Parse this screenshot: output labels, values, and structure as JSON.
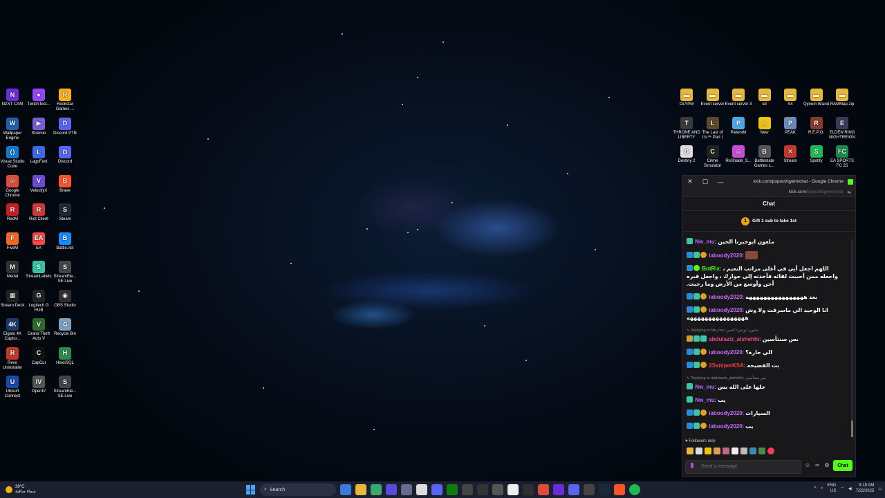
{
  "desktop_left": [
    {
      "label": "NZXT CAM",
      "color": "#6a2bd8",
      "glyph": "N"
    },
    {
      "label": "TwitchTest...",
      "color": "#9146ff",
      "glyph": "●"
    },
    {
      "label": "Rockstar Games ...",
      "color": "#fcaf17",
      "glyph": "R"
    },
    {
      "label": "Wallpaper Engine",
      "color": "#1e5fae",
      "glyph": "W"
    },
    {
      "label": "Stremio",
      "color": "#7b5bd6",
      "glyph": "▶"
    },
    {
      "label": "Discord PTB",
      "color": "#5865f2",
      "glyph": "D"
    },
    {
      "label": "Visual Studio Code",
      "color": "#0e7ad1",
      "glyph": "⟨⟩"
    },
    {
      "label": "LagoFast",
      "color": "#3a6ae8",
      "glyph": "L"
    },
    {
      "label": "Discord",
      "color": "#5865f2",
      "glyph": "D"
    },
    {
      "label": "Google Chrome",
      "color": "#dd4b39",
      "glyph": "◎"
    },
    {
      "label": "VelocityX",
      "color": "#6a4ad8",
      "glyph": "V"
    },
    {
      "label": "Brave",
      "color": "#fb542b",
      "glyph": "B"
    },
    {
      "label": "RedM",
      "color": "#c81d25",
      "glyph": "R"
    },
    {
      "label": "Riot Client",
      "color": "#d13639",
      "glyph": "R"
    },
    {
      "label": "Steam",
      "color": "#1b2838",
      "glyph": "S"
    },
    {
      "label": "FiveM",
      "color": "#f26722",
      "glyph": "F"
    },
    {
      "label": "EA",
      "color": "#ff4747",
      "glyph": "EA"
    },
    {
      "label": "Battle.net",
      "color": "#148eff",
      "glyph": "B"
    },
    {
      "label": "Medal",
      "color": "#333",
      "glyph": "M"
    },
    {
      "label": "StreamLabels",
      "color": "#31c3a2",
      "glyph": "S"
    },
    {
      "label": "StreamEle... SE.Live",
      "color": "#444",
      "glyph": "S"
    },
    {
      "label": "Stream Deck",
      "color": "#222",
      "glyph": "▦"
    },
    {
      "label": "Logitech G HUB",
      "color": "#222",
      "glyph": "G"
    },
    {
      "label": "OBS Studio",
      "color": "#302e31",
      "glyph": "◉"
    },
    {
      "label": "Elgato 4K Captur...",
      "color": "#1a3a6a",
      "glyph": "4K"
    },
    {
      "label": "Grand Theft Auto V",
      "color": "#2a6a2a",
      "glyph": "V"
    },
    {
      "label": "Recycle Bin",
      "color": "#7aa0c0",
      "glyph": "♻"
    },
    {
      "label": "Revo Uninstaller",
      "color": "#c0392b",
      "glyph": "R"
    },
    {
      "label": "CapCut",
      "color": "#111",
      "glyph": "C"
    },
    {
      "label": "HeidiSQL",
      "color": "#2a8a4a",
      "glyph": "H"
    },
    {
      "label": "Ubisoft Connect",
      "color": "#1a4aa8",
      "glyph": "U"
    },
    {
      "label": "OpenIV",
      "color": "#555",
      "glyph": "IV"
    },
    {
      "label": "StreamEle... SE.Live",
      "color": "#444",
      "glyph": "S"
    }
  ],
  "desktop_right": [
    {
      "label": "OLYPM",
      "color": "#e8b83a",
      "glyph": "▬"
    },
    {
      "label": "Event server",
      "color": "#e8b83a",
      "glyph": "▬"
    },
    {
      "label": "Event server 3",
      "color": "#e8b83a",
      "glyph": "▬"
    },
    {
      "label": "sd",
      "color": "#e8b83a",
      "glyph": "▬"
    },
    {
      "label": "S4",
      "color": "#e8b83a",
      "glyph": "▬"
    },
    {
      "label": "Qyeem Brand",
      "color": "#e8b83a",
      "glyph": "▬"
    },
    {
      "label": "RAMMap.zip",
      "color": "#e8b83a",
      "glyph": "▬"
    },
    {
      "label": "THRONE AND LIBERTY",
      "color": "#3a3a3a",
      "glyph": "T"
    },
    {
      "label": "The Last of Us™ Part I",
      "color": "#5a4a2a",
      "glyph": "L"
    },
    {
      "label": "Palworld",
      "color": "#4aa8e8",
      "glyph": "P"
    },
    {
      "label": "New",
      "color": "#f4c20d",
      "glyph": "⚠"
    },
    {
      "label": "PEAK",
      "color": "#6a8ab8",
      "glyph": "P"
    },
    {
      "label": "R.E.P.O.",
      "color": "#8a3a2a",
      "glyph": "R"
    },
    {
      "label": "ELDEN RING NIGHTREIGN",
      "color": "#3a3a5a",
      "glyph": "E"
    },
    {
      "label": "Destiny 2",
      "color": "#ddd",
      "glyph": "D"
    },
    {
      "label": "Crime Simulator",
      "color": "#222",
      "glyph": "C"
    },
    {
      "label": "ReShade_S...",
      "color": "#c84ad8",
      "glyph": "◎"
    },
    {
      "label": "Battlestate Games L...",
      "color": "#555",
      "glyph": "B"
    },
    {
      "label": "Stream",
      "color": "#c0392b",
      "glyph": "✕"
    },
    {
      "label": "Spotify",
      "color": "#1db954",
      "glyph": "S"
    },
    {
      "label": "EA SPORTS FC 25",
      "color": "#1a8a4a",
      "glyph": "FC"
    }
  ],
  "chat_window": {
    "title": "kick.com/popout/qyem/chat - Google Chrome",
    "url_host": "kick.com",
    "url_path": "/popout/qyem/chat",
    "header": "Chat",
    "gift_text": "Gift 1 sub to take 1st",
    "gift_count": "1",
    "messages": [
      {
        "user": "Nw_mu",
        "color": "#b36bff",
        "text": "ملعون ابوخيرنا الحين",
        "reply": ""
      },
      {
        "user": "iaboody2020",
        "color": "#c86bff",
        "text": "",
        "reply": ""
      },
      {
        "user": "BotRix",
        "color": "#53fc18",
        "text": "اللهم اجعل أبي في أعلى مراتب النعيم ، واجعله ممن أحببت لقائه فأخذته إلى جوارك ، واجعل قبره أحن وأوسع من الأرض وما رحبت.",
        "reply": ""
      },
      {
        "user": "iaboody2020",
        "color": "#c86bff",
        "text": "بعد ههههههههههههههههه",
        "reply": ""
      },
      {
        "user": "iaboody2020",
        "color": "#c86bff",
        "text": "انا الوحيد الي ماسرقت ولا وش ههههههههههههههههه",
        "reply": ""
      },
      {
        "user": "abdulaziz_alshehhi",
        "color": "#e84a8a",
        "text": "بس سنتأسين",
        "reply": "Replying to Nw_mu: ملعون ابوخيرنا الحين"
      },
      {
        "user": "iaboody2020",
        "color": "#c86bff",
        "text": "الي حارة؟",
        "reply": ""
      },
      {
        "user": "2SsniperKSA",
        "color": "#ff3a3a",
        "text": "بت الفضيحه",
        "reply": ""
      },
      {
        "user": "Nw_mu",
        "color": "#b36bff",
        "text": "خلها على الله بس",
        "reply": "Replying to abdulaziz_alshehhi: بس سنتأسين"
      },
      {
        "user": "Nw_mu",
        "color": "#b36bff",
        "text": "يب",
        "reply": ""
      },
      {
        "user": "iaboody2020",
        "color": "#c86bff",
        "text": "السيارات",
        "reply": ""
      },
      {
        "user": "iaboody2020",
        "color": "#c86bff",
        "text": "يب",
        "reply": ""
      }
    ],
    "followers_only": "Followers only",
    "input_placeholder": "Send a message",
    "chat_button": "Chat"
  },
  "taskbar": {
    "weather_temp": "38°C",
    "weather_desc": "سماء صافية",
    "search_label": "Search",
    "lang_top": "ENG",
    "lang_bottom": "US",
    "time": "8:19 AM",
    "date": "7/22/2025"
  }
}
